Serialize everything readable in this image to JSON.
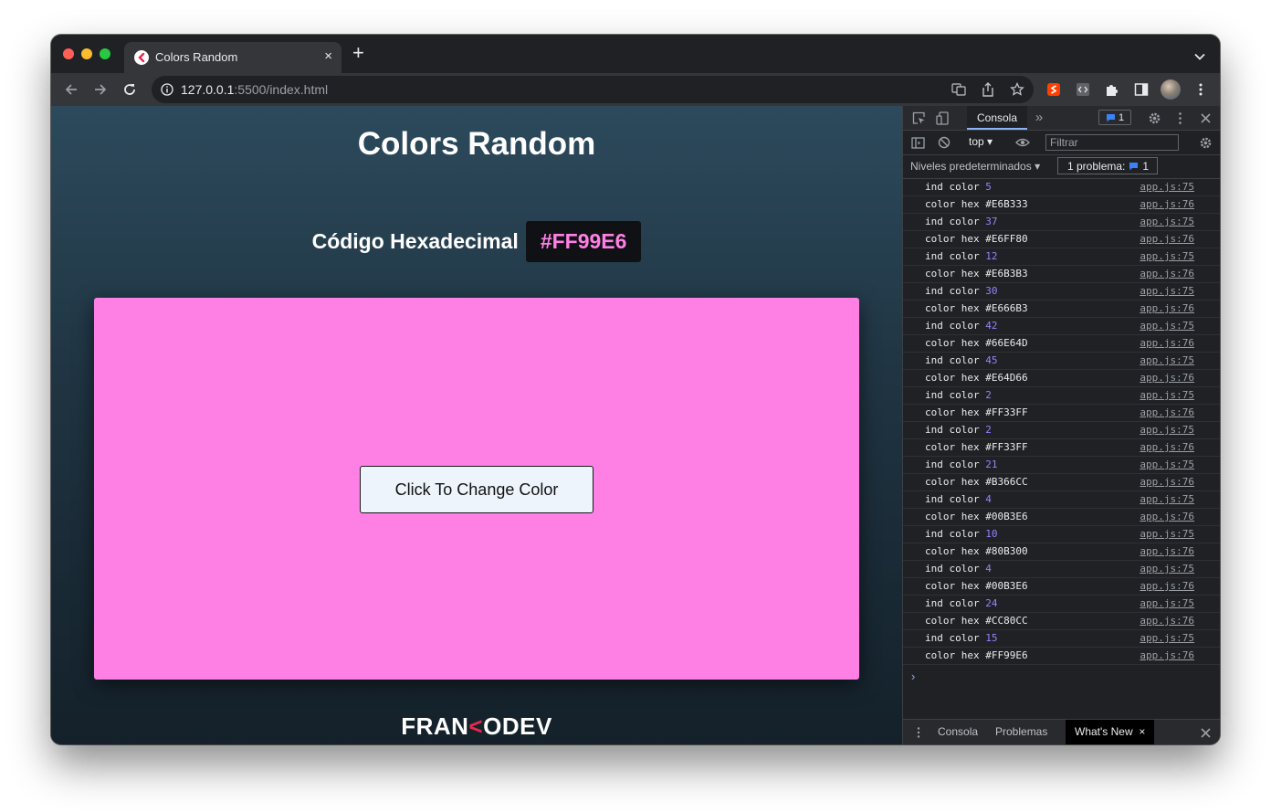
{
  "browser": {
    "tab_title": "Colors Random",
    "tab_close": "×",
    "new_tab": "+",
    "url_host": "127.0.0.1",
    "url_path": ":5500/index.html"
  },
  "page": {
    "title": "Colors Random",
    "hex_label": "Código Hexadecimal",
    "hex_value": "#FF99E6",
    "box_color": "#FF80E5",
    "button_label": "Click To Change Color",
    "brand_left": "FRAN",
    "brand_mark": "<",
    "brand_right": "ODEV"
  },
  "devtools": {
    "active_tab": "Consola",
    "more_tabs": "»",
    "issue_count": "1",
    "context": "top ▾",
    "filter_placeholder": "Filtrar",
    "levels": "Niveles predeterminados ▾",
    "problems_label": "1 problema:",
    "problems_count": "1",
    "prompt": "›",
    "logs": [
      {
        "text": "ind color ",
        "num": "5",
        "src": "app.js:75"
      },
      {
        "text": "color hex #E6B333",
        "num": "",
        "src": "app.js:76"
      },
      {
        "text": "ind color ",
        "num": "37",
        "src": "app.js:75"
      },
      {
        "text": "color hex #E6FF80",
        "num": "",
        "src": "app.js:76"
      },
      {
        "text": "ind color ",
        "num": "12",
        "src": "app.js:75"
      },
      {
        "text": "color hex #E6B3B3",
        "num": "",
        "src": "app.js:76"
      },
      {
        "text": "ind color ",
        "num": "30",
        "src": "app.js:75"
      },
      {
        "text": "color hex #E666B3",
        "num": "",
        "src": "app.js:76"
      },
      {
        "text": "ind color ",
        "num": "42",
        "src": "app.js:75"
      },
      {
        "text": "color hex #66E64D",
        "num": "",
        "src": "app.js:76"
      },
      {
        "text": "ind color ",
        "num": "45",
        "src": "app.js:75"
      },
      {
        "text": "color hex #E64D66",
        "num": "",
        "src": "app.js:76"
      },
      {
        "text": "ind color ",
        "num": "2",
        "src": "app.js:75"
      },
      {
        "text": "color hex #FF33FF",
        "num": "",
        "src": "app.js:76"
      },
      {
        "text": "ind color ",
        "num": "2",
        "src": "app.js:75"
      },
      {
        "text": "color hex #FF33FF",
        "num": "",
        "src": "app.js:76"
      },
      {
        "text": "ind color ",
        "num": "21",
        "src": "app.js:75"
      },
      {
        "text": "color hex #B366CC",
        "num": "",
        "src": "app.js:76"
      },
      {
        "text": "ind color ",
        "num": "4",
        "src": "app.js:75"
      },
      {
        "text": "color hex #00B3E6",
        "num": "",
        "src": "app.js:76"
      },
      {
        "text": "ind color ",
        "num": "10",
        "src": "app.js:75"
      },
      {
        "text": "color hex #80B300",
        "num": "",
        "src": "app.js:76"
      },
      {
        "text": "ind color ",
        "num": "4",
        "src": "app.js:75"
      },
      {
        "text": "color hex #00B3E6",
        "num": "",
        "src": "app.js:76"
      },
      {
        "text": "ind color ",
        "num": "24",
        "src": "app.js:75"
      },
      {
        "text": "color hex #CC80CC",
        "num": "",
        "src": "app.js:76"
      },
      {
        "text": "ind color ",
        "num": "15",
        "src": "app.js:75"
      },
      {
        "text": "color hex #FF99E6",
        "num": "",
        "src": "app.js:76"
      }
    ],
    "drawer_tabs": [
      "Consola",
      "Problemas"
    ],
    "drawer_active": "What's New",
    "drawer_active_close": "×"
  }
}
